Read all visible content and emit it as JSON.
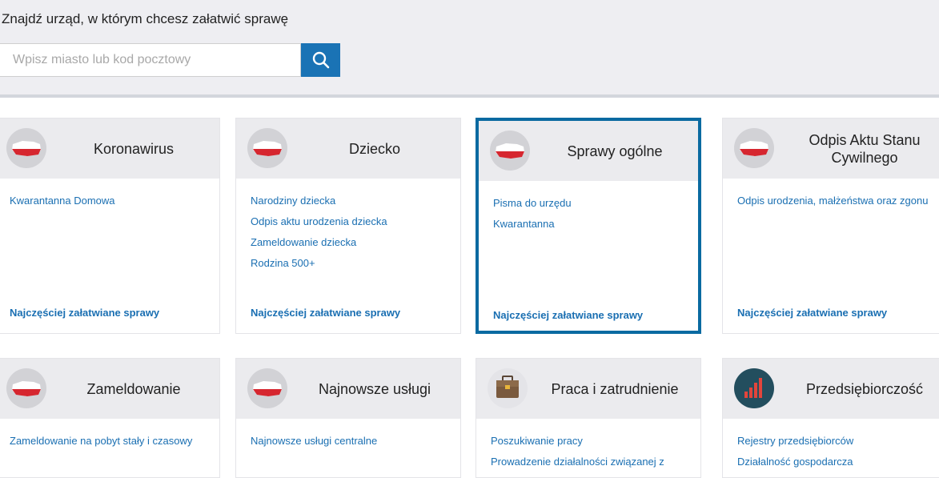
{
  "search": {
    "title": "Znajdź urząd, w którym chcesz załatwić sprawę",
    "placeholder": "Wpisz miasto lub kod pocztowy"
  },
  "colors": {
    "accent": "#1a73b5",
    "link": "#1a6fb2",
    "highlight_border": "#0a6aa1",
    "poland_red": "#d6262f"
  },
  "cards_row1": [
    {
      "title": "Koronawirus",
      "icon": "poland-map-icon",
      "links": [
        "Kwarantanna Domowa"
      ],
      "more": "Najczęściej załatwiane sprawy"
    },
    {
      "title": "Dziecko",
      "icon": "poland-map-icon",
      "links": [
        "Narodziny dziecka",
        "Odpis aktu urodzenia dziecka",
        "Zameldowanie dziecka",
        "Rodzina 500+"
      ],
      "more": "Najczęściej załatwiane sprawy"
    },
    {
      "title": "Sprawy ogólne",
      "icon": "poland-map-icon",
      "links": [
        "Pisma do urzędu",
        "Kwarantanna"
      ],
      "more": "Najczęściej załatwiane sprawy"
    },
    {
      "title": "Odpis Aktu Stanu Cywilnego",
      "icon": "poland-map-icon",
      "links": [
        "Odpis urodzenia, małżeństwa oraz zgonu"
      ],
      "more": "Najczęściej załatwiane sprawy"
    }
  ],
  "cards_row2": [
    {
      "title": "Zameldowanie",
      "icon": "poland-map-icon",
      "links": [
        "Zameldowanie na pobyt stały i czasowy"
      ]
    },
    {
      "title": "Najnowsze usługi",
      "icon": "poland-map-icon",
      "links": [
        "Najnowsze usługi centralne"
      ]
    },
    {
      "title": "Praca i zatrudnienie",
      "icon": "briefcase-icon",
      "links": [
        "Poszukiwanie pracy",
        "Prowadzenie działalności związanej z"
      ]
    },
    {
      "title": "Przedsiębiorczość",
      "icon": "bar-chart-icon",
      "links": [
        "Rejestry przedsiębiorców",
        "Działalność gospodarcza"
      ]
    }
  ]
}
